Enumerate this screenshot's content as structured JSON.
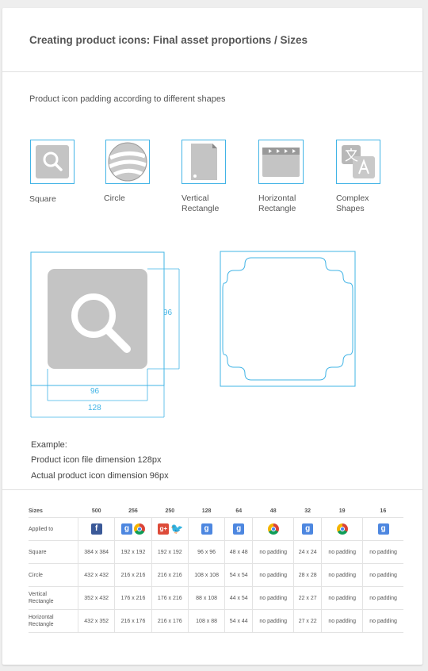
{
  "header": {
    "title": "Creating product icons: Final asset proportions / Sizes"
  },
  "section": {
    "subtitle": "Product icon padding according to different shapes"
  },
  "shapes": [
    {
      "label": "Square",
      "icon": "search-icon"
    },
    {
      "label": "Circle",
      "icon": "google-earth-icon"
    },
    {
      "label": "Vertical\nRectangle",
      "icon": "document-icon"
    },
    {
      "label": "Horizontal\nRectangle",
      "icon": "clapperboard-icon"
    },
    {
      "label": "Complex\nShapes",
      "icon": "translate-icon"
    }
  ],
  "diagram": {
    "inner_width": "96",
    "inner_height": "96",
    "outer_width": "128"
  },
  "example": {
    "heading": "Example:",
    "line1": "Product icon file dimension 128px",
    "line2": "Actual product icon dimension 96px"
  },
  "table": {
    "headers": [
      "Sizes",
      "500",
      "256",
      "250",
      "128",
      "64",
      "48",
      "32",
      "19",
      "16"
    ],
    "applied_label": "Applied to",
    "applied_icons": [
      [
        "facebook-icon"
      ],
      [
        "google-plus-icon",
        "chrome-icon"
      ],
      [
        "gplus-red-icon",
        "twitter-icon"
      ],
      [
        "google-plus-icon"
      ],
      [
        "google-plus-icon"
      ],
      [
        "chrome-icon"
      ],
      [
        "google-plus-icon"
      ],
      [
        "chrome-icon"
      ],
      [
        "google-plus-icon"
      ]
    ],
    "rows": [
      {
        "label": "Square",
        "values": [
          "384 x 384",
          "192 x 192",
          "192 x 192",
          "96 x 96",
          "48 x 48",
          "no padding",
          "24 x 24",
          "no padding",
          "no padding"
        ]
      },
      {
        "label": "Circle",
        "values": [
          "432 x 432",
          "216 x 216",
          "216 x 216",
          "108 x 108",
          "54 x 54",
          "no padding",
          "28 x 28",
          "no padding",
          "no padding"
        ]
      },
      {
        "label": "Vertical\nRectangle",
        "values": [
          "352 x 432",
          "176 x 216",
          "176 x 216",
          "88 x 108",
          "44 x 54",
          "no padding",
          "22 x 27",
          "no padding",
          "no padding"
        ]
      },
      {
        "label": "Horizontal\nRectangle",
        "values": [
          "432 x 352",
          "216 x 176",
          "216 x 176",
          "108 x 88",
          "54 x 44",
          "no padding",
          "27 x 22",
          "no padding",
          "no padding"
        ]
      }
    ]
  },
  "colors": {
    "accent": "#42b4e6",
    "icon_gray": "#c4c4c4"
  }
}
